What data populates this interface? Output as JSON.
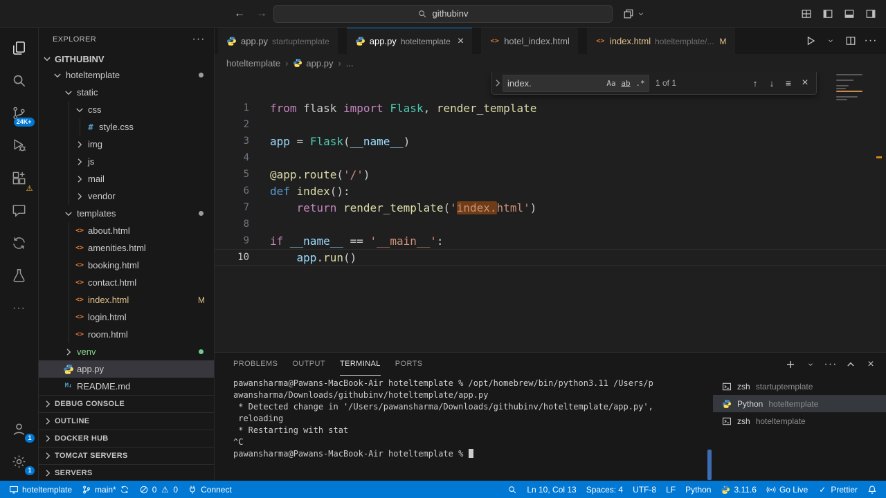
{
  "colors": {
    "accent": "#0078d4",
    "modified": "#e2c08d",
    "added_green": "#73c991",
    "warning": "#f0c23c",
    "find_match_bg": "#6e3c17"
  },
  "titlebar": {
    "search_text": "githubinv"
  },
  "activity_bar": {
    "top": [
      {
        "id": "explorer",
        "icon": "files",
        "active": true
      },
      {
        "id": "search",
        "icon": "search"
      },
      {
        "id": "source-control",
        "icon": "scm",
        "badge": "24K+"
      },
      {
        "id": "run-debug",
        "icon": "debug"
      },
      {
        "id": "extensions",
        "icon": "extensions",
        "warning": true
      },
      {
        "id": "comments",
        "icon": "comment"
      },
      {
        "id": "remote",
        "icon": "sync"
      },
      {
        "id": "testing",
        "icon": "beaker"
      },
      {
        "id": "more",
        "icon": "more"
      }
    ],
    "bottom": [
      {
        "id": "accounts",
        "icon": "account",
        "badge": "1"
      },
      {
        "id": "settings",
        "icon": "gear",
        "badge": "1"
      }
    ]
  },
  "explorer": {
    "title": "EXPLORER",
    "workspace": "GITHUBINV",
    "tree": [
      {
        "label": "hoteltemplate",
        "kind": "folder",
        "expanded": true,
        "depth": 0,
        "dot": "grey"
      },
      {
        "label": "static",
        "kind": "folder",
        "expanded": true,
        "depth": 1
      },
      {
        "label": "css",
        "kind": "folder",
        "expanded": true,
        "depth": 2
      },
      {
        "label": "style.css",
        "kind": "file",
        "icon": "css",
        "depth": 3
      },
      {
        "label": "img",
        "kind": "folder",
        "depth": 2
      },
      {
        "label": "js",
        "kind": "folder",
        "depth": 2
      },
      {
        "label": "mail",
        "kind": "folder",
        "depth": 2
      },
      {
        "label": "vendor",
        "kind": "folder",
        "depth": 2
      },
      {
        "label": "templates",
        "kind": "folder",
        "expanded": true,
        "depth": 1,
        "dot": "grey"
      },
      {
        "label": "about.html",
        "kind": "file",
        "icon": "html",
        "depth": 2
      },
      {
        "label": "amenities.html",
        "kind": "file",
        "icon": "html",
        "depth": 2
      },
      {
        "label": "booking.html",
        "kind": "file",
        "icon": "html",
        "depth": 2
      },
      {
        "label": "contact.html",
        "kind": "file",
        "icon": "html",
        "depth": 2
      },
      {
        "label": "index.html",
        "kind": "file",
        "icon": "html",
        "depth": 2,
        "badge": "M",
        "color": "modified"
      },
      {
        "label": "login.html",
        "kind": "file",
        "icon": "html",
        "depth": 2
      },
      {
        "label": "room.html",
        "kind": "file",
        "icon": "html",
        "depth": 2
      },
      {
        "label": "venv",
        "kind": "folder",
        "depth": 1,
        "dot": "green",
        "color": "green"
      },
      {
        "label": "app.py",
        "kind": "file",
        "icon": "python",
        "depth": 1,
        "selected": true
      },
      {
        "label": "README.md",
        "kind": "file",
        "icon": "markdown",
        "depth": 1
      }
    ],
    "sections": [
      "DEBUG CONSOLE",
      "OUTLINE",
      "DOCKER HUB",
      "TOMCAT SERVERS",
      "SERVERS"
    ]
  },
  "editor_tabs": [
    {
      "name": "app.py",
      "desc": "startuptemplate",
      "icon": "python"
    },
    {
      "name": "app.py",
      "desc": "hoteltemplate",
      "icon": "python",
      "active": true,
      "close": true
    },
    {
      "name": "hotel_index.html",
      "desc": "",
      "icon": "html"
    },
    {
      "name": "index.html",
      "desc": "hoteltemplate/...",
      "icon": "html",
      "badge": "M",
      "modified": true
    }
  ],
  "breadcrumbs": [
    {
      "label": "hoteltemplate"
    },
    {
      "label": "app.py",
      "icon": "python"
    },
    {
      "label": "..."
    }
  ],
  "find": {
    "query": "index.",
    "results": "1 of 1",
    "case": "Aa",
    "word": "ab",
    "regex": ".*"
  },
  "code": {
    "active_line": 10,
    "lines": [
      {
        "n": 1,
        "tokens": [
          [
            "k",
            "from"
          ],
          [
            "p",
            " flask "
          ],
          [
            "k",
            "import"
          ],
          [
            "p",
            " "
          ],
          [
            "c",
            "Flask"
          ],
          [
            "p",
            ", "
          ],
          [
            "f",
            "render_template"
          ]
        ]
      },
      {
        "n": 2,
        "tokens": []
      },
      {
        "n": 3,
        "tokens": [
          [
            "v",
            "app"
          ],
          [
            "p",
            " = "
          ],
          [
            "c",
            "Flask"
          ],
          [
            "p",
            "("
          ],
          [
            "v",
            "__name__"
          ],
          [
            "p",
            ")"
          ]
        ]
      },
      {
        "n": 4,
        "tokens": []
      },
      {
        "n": 5,
        "tokens": [
          [
            "f",
            "@app.route"
          ],
          [
            "p",
            "("
          ],
          [
            "s",
            "'/'"
          ],
          [
            "p",
            ")"
          ]
        ]
      },
      {
        "n": 6,
        "tokens": [
          [
            "b",
            "def"
          ],
          [
            "p",
            " "
          ],
          [
            "f",
            "index"
          ],
          [
            "p",
            "():"
          ]
        ]
      },
      {
        "n": 7,
        "tokens": [
          [
            "p",
            "    "
          ],
          [
            "k",
            "return"
          ],
          [
            "p",
            " "
          ],
          [
            "f",
            "render_template"
          ],
          [
            "p",
            "("
          ],
          [
            "s",
            "'"
          ],
          [
            "m",
            "index."
          ],
          [
            "s",
            "html'"
          ],
          [
            "p",
            ")"
          ]
        ]
      },
      {
        "n": 8,
        "tokens": []
      },
      {
        "n": 9,
        "tokens": [
          [
            "k",
            "if"
          ],
          [
            "p",
            " "
          ],
          [
            "v",
            "__name__"
          ],
          [
            "p",
            " == "
          ],
          [
            "s",
            "'__main__'"
          ],
          [
            "p",
            ":"
          ]
        ]
      },
      {
        "n": 10,
        "tokens": [
          [
            "p",
            "    "
          ],
          [
            "v",
            "app"
          ],
          [
            "p",
            "."
          ],
          [
            "f",
            "run"
          ],
          [
            "p",
            "()"
          ]
        ]
      }
    ]
  },
  "panel": {
    "tabs": [
      {
        "label": "PROBLEMS"
      },
      {
        "label": "OUTPUT"
      },
      {
        "label": "TERMINAL",
        "active": true
      },
      {
        "label": "PORTS"
      }
    ],
    "terminal_lines": [
      {
        "text": "pawansharma@Pawans-MacBook-Air hoteltemplate % /opt/homebrew/bin/python3.11 /Users/p"
      },
      {
        "text": "awansharma/Downloads/githubinv/hoteltemplate/app.py"
      },
      {
        "text": " * Detected change in '/Users/pawansharma/Downloads/githubinv/hoteltemplate/app.py',"
      },
      {
        "text": " reloading"
      },
      {
        "text": " * Restarting with stat"
      },
      {
        "text": "^C"
      },
      {
        "text": "pawansharma@Pawans-MacBook-Air hoteltemplate % ",
        "prompt": true,
        "deco": true
      }
    ],
    "terminals": [
      {
        "shell": "zsh",
        "label": "startuptemplate",
        "icon": "terminal"
      },
      {
        "shell": "Python",
        "label": "hoteltemplate",
        "icon": "python",
        "selected": true
      },
      {
        "shell": "zsh",
        "label": "hoteltemplate",
        "icon": "terminal"
      }
    ]
  },
  "statusbar": {
    "left": [
      {
        "id": "remote",
        "icon": "monitor",
        "label": "hoteltemplate"
      },
      {
        "id": "branch",
        "icon": "branch",
        "label": "main*",
        "suffix_icon": "sync"
      },
      {
        "id": "problems",
        "errors": "0",
        "warnings": "0"
      },
      {
        "id": "connect",
        "icon": "plug",
        "label": "Connect"
      }
    ],
    "right": [
      {
        "id": "search-status",
        "icon": "search",
        "label": ""
      },
      {
        "id": "cursor-position",
        "label": "Ln 10, Col 13"
      },
      {
        "id": "indentation",
        "label": "Spaces: 4"
      },
      {
        "id": "encoding",
        "label": "UTF-8"
      },
      {
        "id": "eol",
        "label": "LF"
      },
      {
        "id": "language",
        "label": "Python"
      },
      {
        "id": "interpreter",
        "icon": "python",
        "label": "3.11.6"
      },
      {
        "id": "go-live",
        "icon": "broadcast",
        "label": "Go Live"
      },
      {
        "id": "prettier",
        "icon": "check",
        "label": "Prettier"
      },
      {
        "id": "notifications",
        "icon": "bell",
        "label": ""
      }
    ]
  }
}
